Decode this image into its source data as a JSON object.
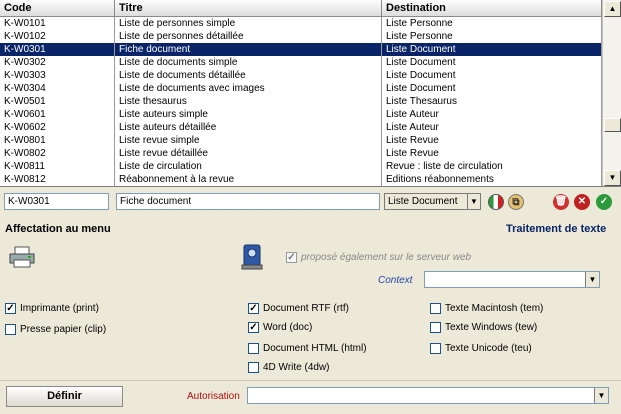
{
  "table": {
    "headers": {
      "code": "Code",
      "titre": "Titre",
      "destination": "Destination"
    },
    "rows": [
      {
        "code": "K-W0101",
        "titre": "Liste de personnes simple",
        "destination": "Liste Personne"
      },
      {
        "code": "K-W0102",
        "titre": "Liste de personnes détaillée",
        "destination": "Liste Personne"
      },
      {
        "code": "K-W0301",
        "titre": "Fiche document",
        "destination": "Liste Document",
        "selected": true
      },
      {
        "code": "K-W0302",
        "titre": "Liste de documents simple",
        "destination": "Liste Document"
      },
      {
        "code": "K-W0303",
        "titre": "Liste de documents détaillée",
        "destination": "Liste Document"
      },
      {
        "code": "K-W0304",
        "titre": "Liste de documents avec images",
        "destination": "Liste Document"
      },
      {
        "code": "K-W0501",
        "titre": "Liste thesaurus",
        "destination": "Liste Thesaurus"
      },
      {
        "code": "K-W0601",
        "titre": "Liste auteurs simple",
        "destination": "Liste Auteur"
      },
      {
        "code": "K-W0602",
        "titre": "Liste auteurs détaillée",
        "destination": "Liste Auteur"
      },
      {
        "code": "K-W0801",
        "titre": "Liste revue simple",
        "destination": "Liste Revue"
      },
      {
        "code": "K-W0802",
        "titre": "Liste revue détaillée",
        "destination": "Liste Revue"
      },
      {
        "code": "K-W0811",
        "titre": "Liste de circulation",
        "destination": "Revue : liste de circulation"
      },
      {
        "code": "K-W0812",
        "titre": "Réabonnement à la revue",
        "destination": "Editions réabonnements"
      }
    ]
  },
  "edit": {
    "code_value": "K-W0301",
    "titre_value": "Fiche document",
    "destination_value": "Liste Document"
  },
  "toolbar_icons": [
    "italy-flag-icon",
    "copy-icon",
    "trash-icon",
    "cancel-icon",
    "validate-icon"
  ],
  "affectation": {
    "title": "Affectation au menu",
    "right_title": "Traitement de texte",
    "server_label": "proposé également sur le serveur web",
    "server_checked": true,
    "context_label": "Context",
    "context_value": ""
  },
  "outputs": [
    {
      "label": "Imprimante (print)",
      "checked": true
    },
    {
      "label": "Presse papier (clip)",
      "checked": false
    }
  ],
  "formats_mid": [
    {
      "label": "Document RTF (rtf)",
      "checked": true
    },
    {
      "label": "Word (doc)",
      "checked": true
    },
    {
      "label": "Document HTML (html)",
      "checked": false
    },
    {
      "label": "4D Write (4dw)",
      "checked": false
    }
  ],
  "formats_right": [
    {
      "label": "Texte Macintosh (tem)",
      "checked": false
    },
    {
      "label": "Texte Windows (tew)",
      "checked": false
    },
    {
      "label": "Texte Unicode (teu)",
      "checked": false
    }
  ],
  "footer": {
    "define_button": "Définir",
    "autorisation_label": "Autorisation",
    "autorisation_value": ""
  },
  "colors": {
    "selection": "#0a2468",
    "accent_label": "#b01010",
    "context_label": "#2244aa",
    "title_blue": "#0a2468"
  }
}
